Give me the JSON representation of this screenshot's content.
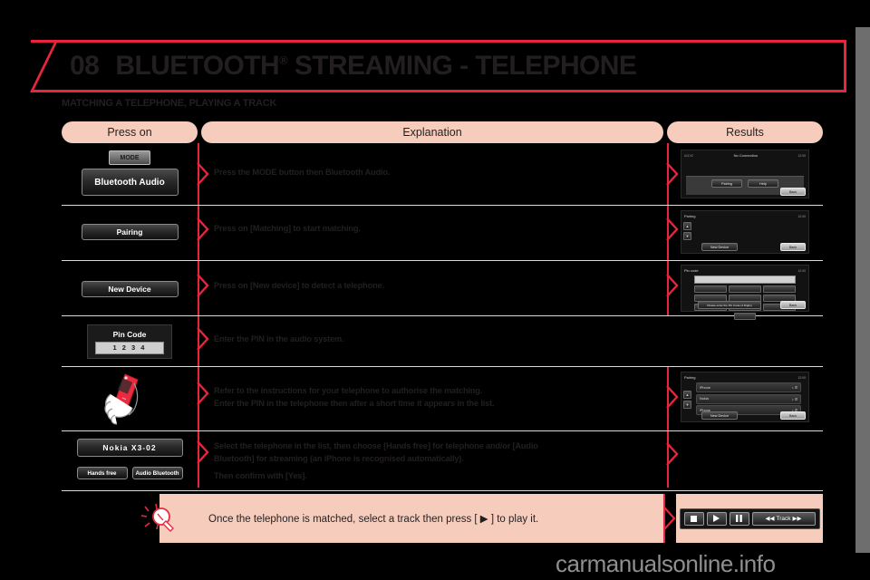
{
  "header": {
    "chapter_number": "08",
    "title": "BLUETOOTH",
    "title_sup": "®",
    "title_rest": " STREAMING - TELEPHONE",
    "accent_color": "#e8253c"
  },
  "subtitle": "MATCHING A TELEPHONE, PLAYING A TRACK",
  "table": {
    "columns": {
      "press_on": "Press on",
      "explanation": "Explanation",
      "results": "Results"
    },
    "header_bg": "#f6cdbc",
    "rows": [
      {
        "press_buttons": [
          "MODE",
          "Bluetooth Audio"
        ],
        "explanation": [
          "Press the MODE button then Bluetooth Audio."
        ],
        "screen": {
          "logo": "AUDIO",
          "title": "No Connection",
          "clock": "12:00",
          "buttons": [
            "Pairing",
            "Help"
          ],
          "back": "Back"
        }
      },
      {
        "press_buttons": [
          "Pairing"
        ],
        "explanation": [
          "Press on [Matching] to start matching."
        ],
        "screen": {
          "title": "Pairing",
          "clock": "12:00",
          "buttons": [
            "New Device"
          ],
          "back": "Back"
        }
      },
      {
        "press_buttons": [
          "New Device"
        ],
        "explanation": [
          "Press on [New device] to detect a telephone."
        ],
        "screen": {
          "title": "Pin code",
          "clock": "12:00",
          "hint": "Please enter the Pin Code (4 Digits)",
          "back": "Back"
        }
      },
      {
        "press_pin": {
          "label": "Pin Code",
          "digits": "1 2 3 4"
        },
        "explanation": [
          "Enter the PIN in the audio system."
        ],
        "screen": null
      },
      {
        "press_illustration": "hand-holding-phone",
        "explanation": [
          "Refer to the instructions for your telephone to authorise the matching.",
          "Enter the PIN in the telephone then after a short time it appears in the list."
        ],
        "screen": {
          "title": "Pairing",
          "clock": "12:00",
          "devices": [
            "iPhone",
            "Nokia",
            "iPhone"
          ],
          "buttons": [
            "New Device"
          ],
          "back": "Back"
        }
      },
      {
        "press_buttons": [
          "Nokia  X3-02"
        ],
        "press_small_buttons": [
          "Hands free",
          "Audio Bluetooth"
        ],
        "explanation": [
          "Select the telephone in the list, then choose [Hands free] for telephone and/or [Audio",
          "Bluetooth] for streaming (an iPhone is recognised automatically).",
          "Then confirm with [Yes]."
        ],
        "screen": null
      }
    ]
  },
  "note": {
    "icon": "lightbulb-icon",
    "text": "Once the telephone is matched, select a track then press [ ▶ ] to play it.",
    "media_controls": {
      "stop": "stop-icon",
      "play": "play-icon",
      "pause": "pause-icon",
      "track_label": "Track",
      "prev": "prev-icon",
      "next": "next-icon"
    }
  },
  "watermark": "carmanualsonline.info"
}
